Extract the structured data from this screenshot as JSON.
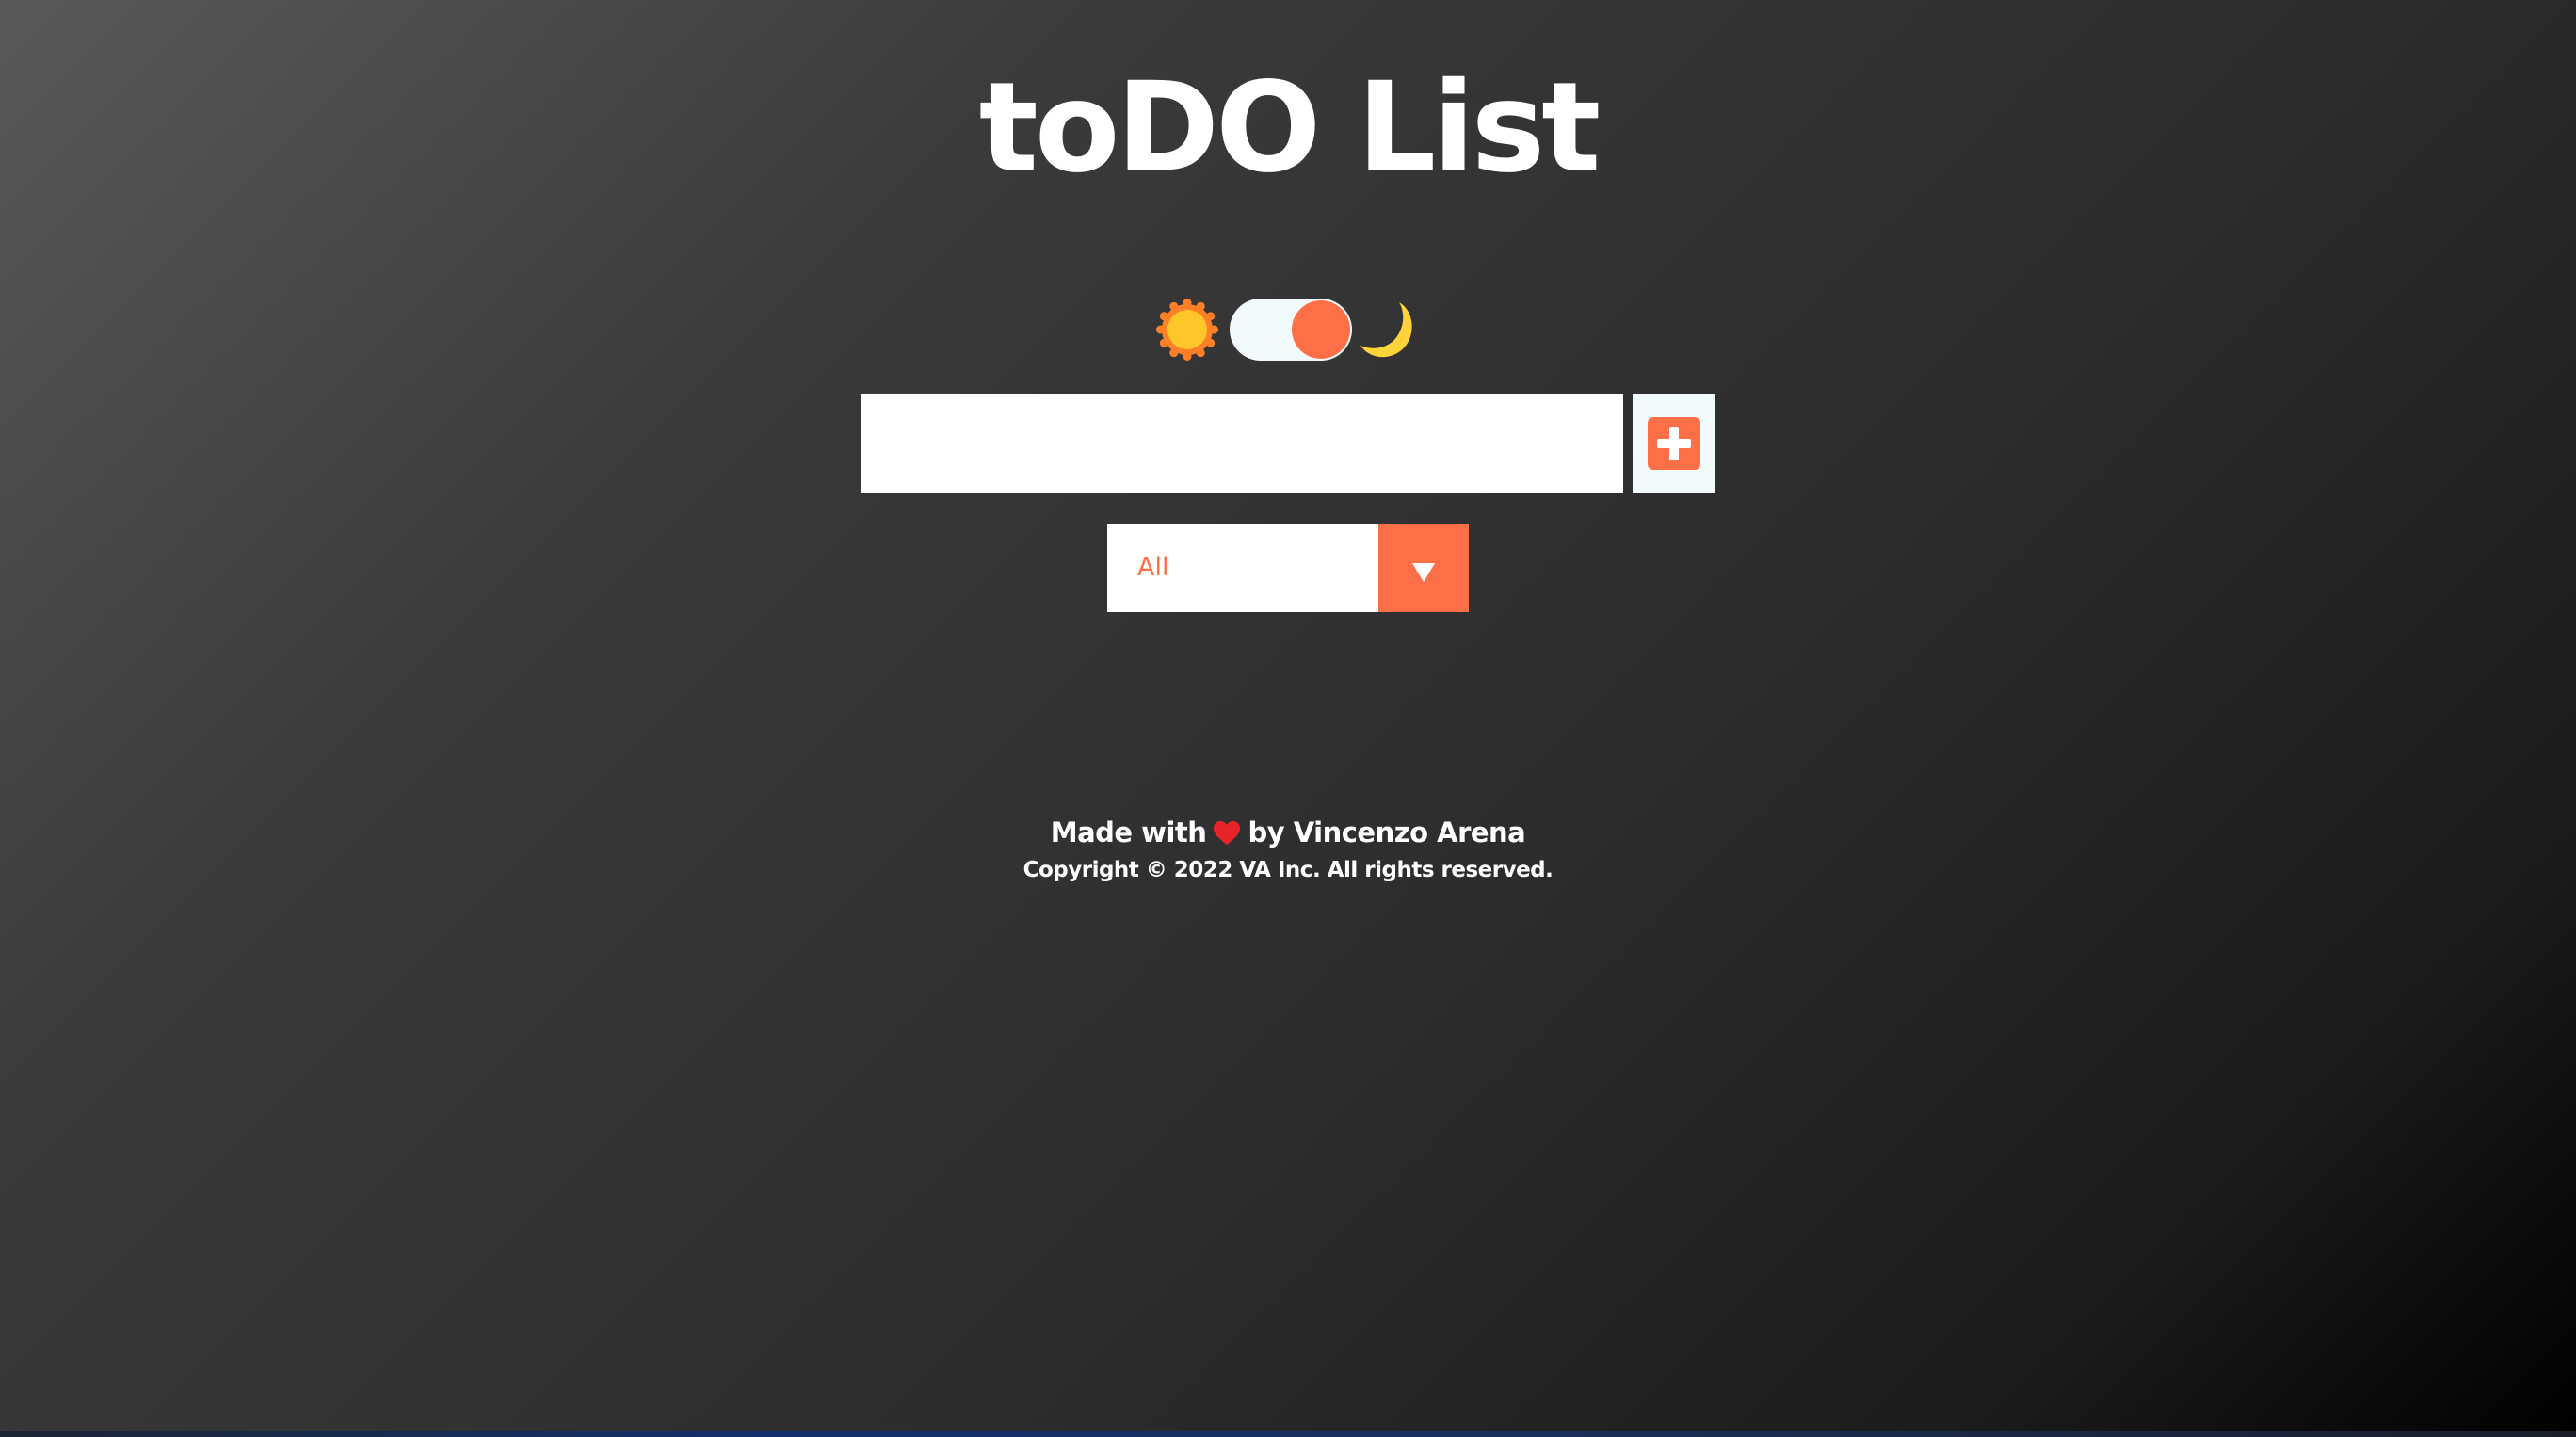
{
  "header": {
    "title": "toDO List"
  },
  "theme_switch": {
    "left_icon": "sun-icon",
    "right_icon": "moon-icon",
    "mode": "dark"
  },
  "todo_form": {
    "input_value": "",
    "input_placeholder": "",
    "add_icon": "plus-icon"
  },
  "filter": {
    "selected": "All",
    "icon": "chevron-down-icon"
  },
  "footer": {
    "made_with": "Made with",
    "heart_icon": "heart-icon",
    "by": "by Vincenzo Arena",
    "copyright": "Copyright © 2022 VA Inc. All rights reserved."
  },
  "colors": {
    "accent": "#ff6f47",
    "heart": "#e8242b",
    "sun": "#ffc629",
    "moon": "#ffd43b",
    "toggle_track": "#f2fbfb"
  }
}
